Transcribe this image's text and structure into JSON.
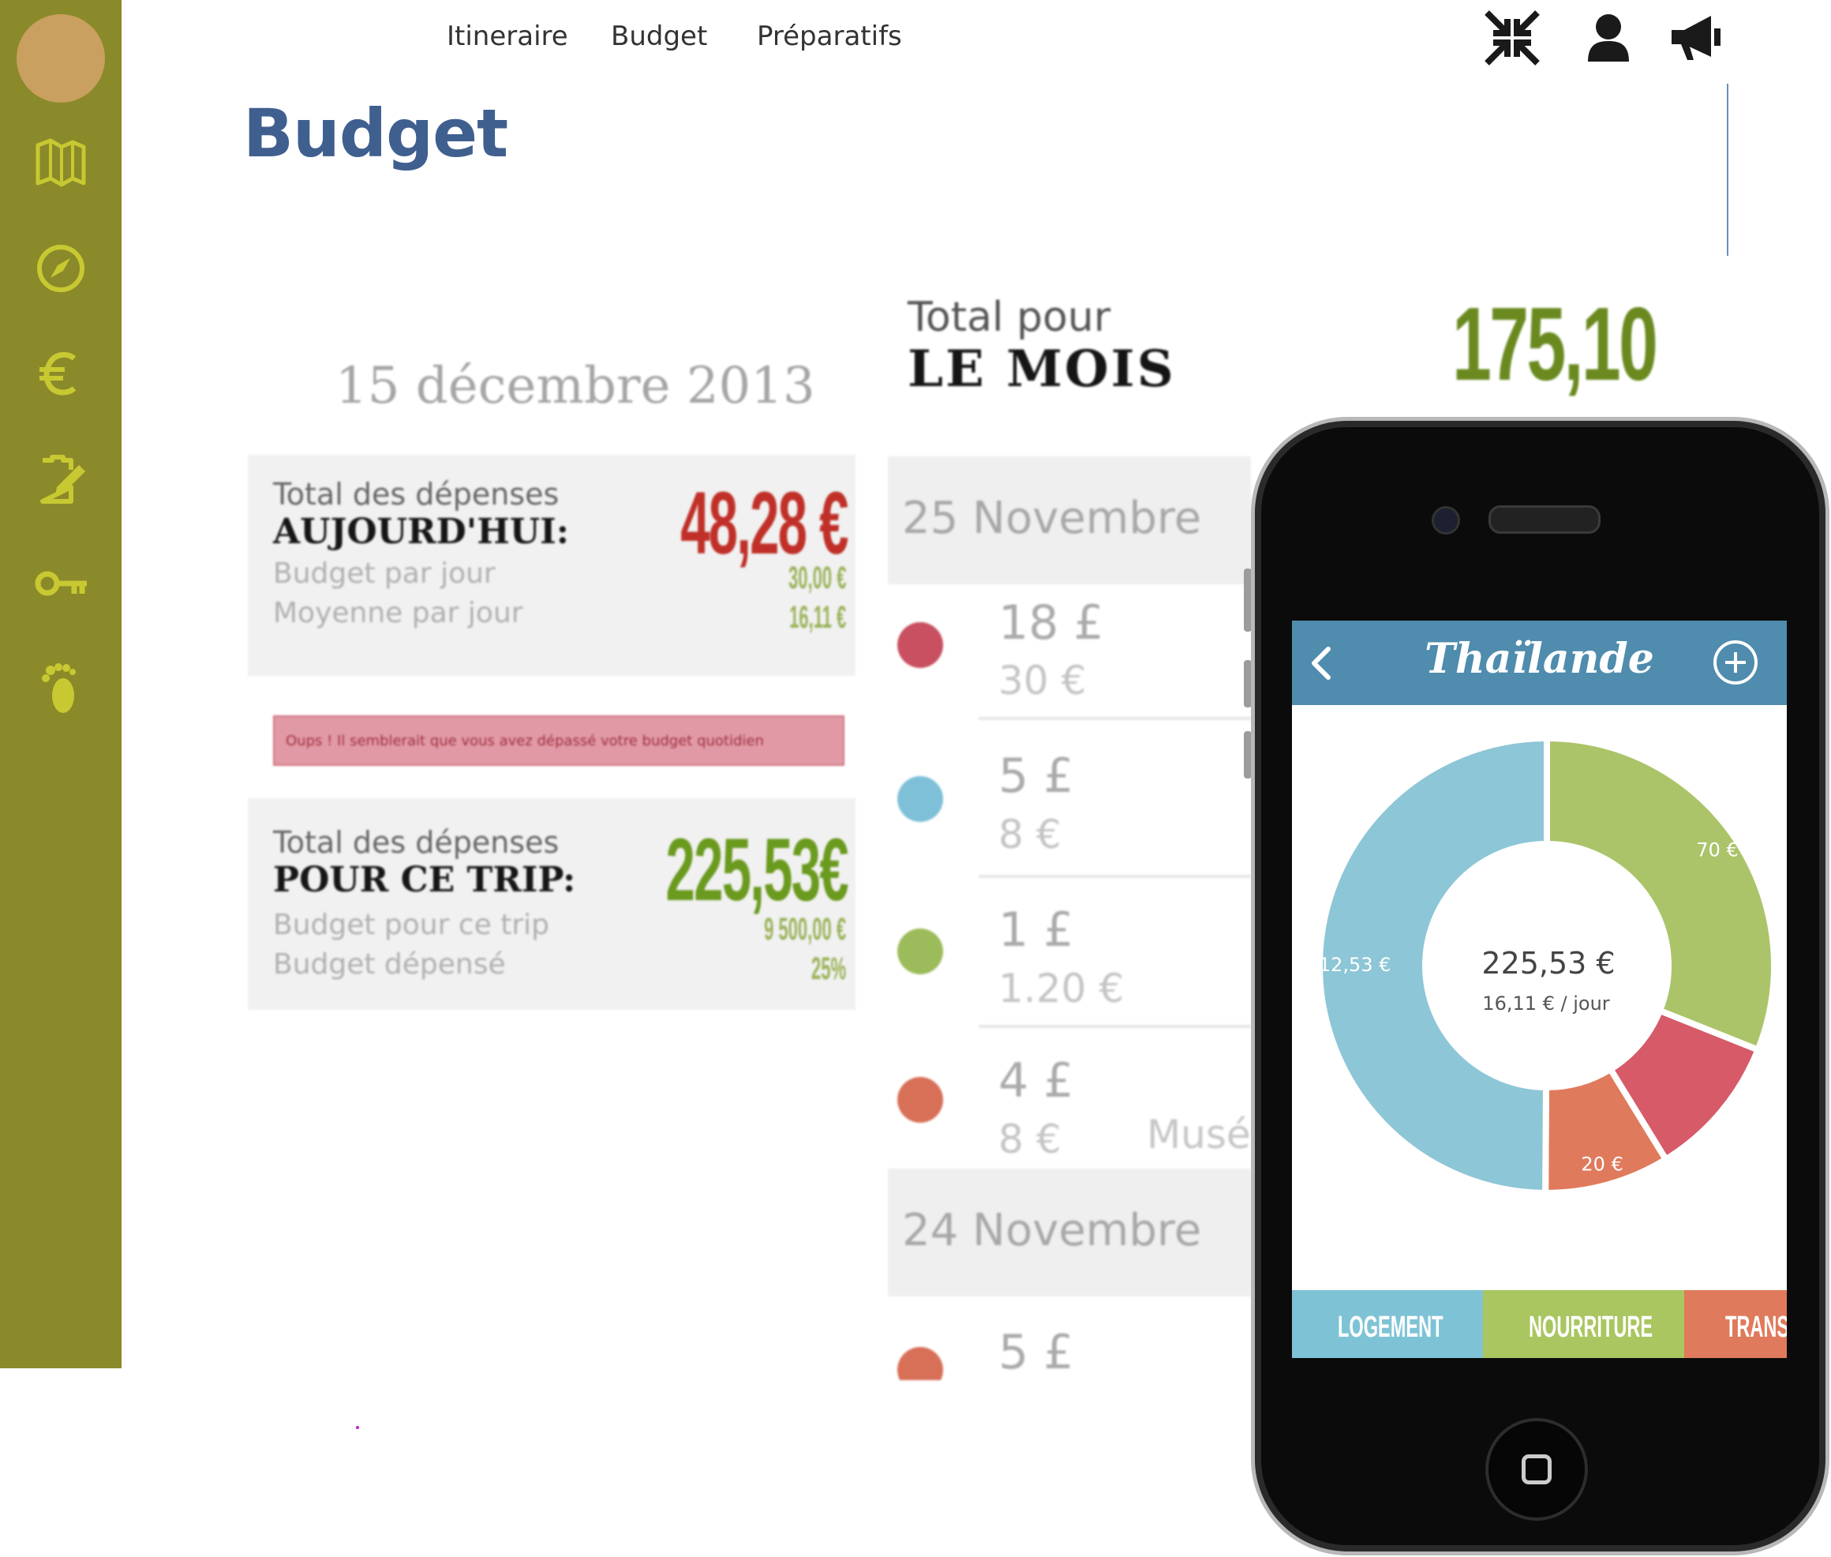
{
  "nav": {
    "items": [
      "Itineraire",
      "Budget",
      "Préparatifs"
    ]
  },
  "top_icons": [
    "collapse-icon",
    "user-icon",
    "megaphone-icon"
  ],
  "sidebar": {
    "icons": [
      "map-icon",
      "compass-icon",
      "euro-icon",
      "clipboard-edit-icon",
      "key-icon",
      "footprint-icon"
    ],
    "color": "#8a8a2a"
  },
  "page": {
    "title": "Budget"
  },
  "budget_screenshot": {
    "date": "15 décembre 2013",
    "month": {
      "line1": "Total pour",
      "line2": "LE MOIS",
      "total": "175,10 €"
    },
    "today": {
      "line1": "Total des dépenses",
      "line2": "AUJOURD'HUI:",
      "sub1": "Budget par jour",
      "sub2": "Moyenne par jour",
      "amount": "48,28 €",
      "value1": "30,00 €",
      "value2": "16,11 €"
    },
    "alert": "Oups ! Il semblerait que vous avez dépassé votre budget quotidien",
    "trip": {
      "line1": "Total des dépenses",
      "line2": "POUR CE TRIP:",
      "sub1": "Budget pour ce trip",
      "sub2": "Budget dépensé",
      "amount": "225,53€",
      "value1": "9 500,00 €",
      "value2": "25%"
    },
    "days": [
      {
        "label": "25 Novembre",
        "entries": [
          {
            "amount": "18 £",
            "converted": "30 €",
            "color": "#c85060"
          },
          {
            "amount": "5 £",
            "converted": "8 €",
            "color": "#7ec0d8"
          },
          {
            "amount": "1 £",
            "converted": "1.20 €",
            "color": "#9cbb5a"
          },
          {
            "amount": "4 £",
            "converted": "8 €",
            "color": "#d87058",
            "place": "Musé"
          }
        ]
      },
      {
        "label": "24 Novembre",
        "entries": [
          {
            "amount": "5 £",
            "color": "#d87058"
          }
        ]
      }
    ]
  },
  "phone_app": {
    "title": "Thaïlande",
    "center_amount": "225,53 €",
    "center_sub": "16,11 € / jour",
    "tabs": [
      {
        "label": "LOGEMENT",
        "color": "#7ec3d5"
      },
      {
        "label": "NOURRITURE",
        "color": "#a9c660"
      },
      {
        "label": "TRANS",
        "color": "#e07a5c"
      }
    ]
  },
  "chart_data": {
    "type": "pie",
    "center_label": "225,53 €",
    "center_sublabel": "16,11 € / jour",
    "slices": [
      {
        "label": "112,53 €",
        "value": 112.53,
        "color": "#8dc6d6"
      },
      {
        "label": "70 €",
        "value": 70,
        "color": "#abc46a"
      },
      {
        "label": "",
        "value": 23,
        "color": "#d65a68"
      },
      {
        "label": "20 €",
        "value": 20,
        "color": "#e07a5c"
      }
    ]
  }
}
